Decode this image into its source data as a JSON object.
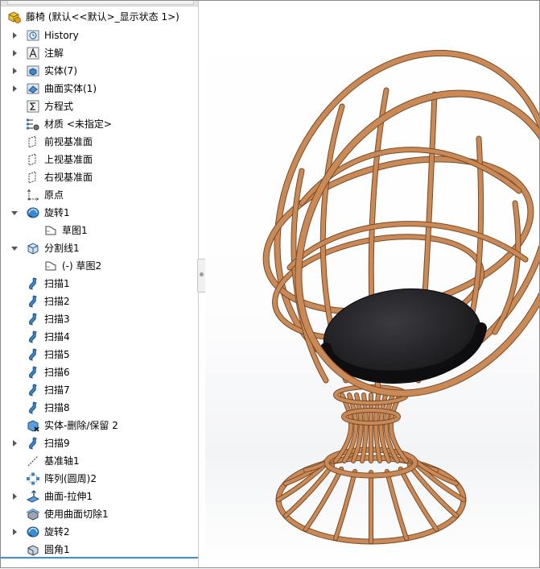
{
  "tree": {
    "root_label": "藤椅  (默认<<默认>_显示状态 1>)",
    "items": [
      {
        "label": "History",
        "icon": "history-icon",
        "expander": "collapsed",
        "indent": 0
      },
      {
        "label": "注解",
        "icon": "annotations-icon",
        "expander": "collapsed",
        "indent": 0
      },
      {
        "label": "实体(7)",
        "icon": "solid-bodies-icon",
        "expander": "collapsed",
        "indent": 0
      },
      {
        "label": "曲面实体(1)",
        "icon": "surface-bodies-icon",
        "expander": "collapsed",
        "indent": 0
      },
      {
        "label": "方程式",
        "icon": "equations-icon",
        "expander": "none",
        "indent": 0
      },
      {
        "label": "材质 <未指定>",
        "icon": "material-icon",
        "expander": "none",
        "indent": 0
      },
      {
        "label": "前视基准面",
        "icon": "plane-icon",
        "expander": "none",
        "indent": 0
      },
      {
        "label": "上视基准面",
        "icon": "plane-icon",
        "expander": "none",
        "indent": 0
      },
      {
        "label": "右视基准面",
        "icon": "plane-icon",
        "expander": "none",
        "indent": 0
      },
      {
        "label": "原点",
        "icon": "origin-icon",
        "expander": "none",
        "indent": 0
      },
      {
        "label": "旋转1",
        "icon": "revolve-icon",
        "expander": "expanded",
        "indent": 0
      },
      {
        "label": "草图1",
        "icon": "sketch-icon",
        "expander": "none",
        "indent": 1
      },
      {
        "label": "分割线1",
        "icon": "split-line-icon",
        "expander": "expanded",
        "indent": 0
      },
      {
        "label": "(-) 草图2",
        "icon": "sketch-icon",
        "expander": "none",
        "indent": 1
      },
      {
        "label": "扫描1",
        "icon": "sweep-icon",
        "expander": "none",
        "indent": 0
      },
      {
        "label": "扫描2",
        "icon": "sweep-icon",
        "expander": "none",
        "indent": 0
      },
      {
        "label": "扫描3",
        "icon": "sweep-icon",
        "expander": "none",
        "indent": 0
      },
      {
        "label": "扫描4",
        "icon": "sweep-icon",
        "expander": "none",
        "indent": 0
      },
      {
        "label": "扫描5",
        "icon": "sweep-icon",
        "expander": "none",
        "indent": 0
      },
      {
        "label": "扫描6",
        "icon": "sweep-icon",
        "expander": "none",
        "indent": 0
      },
      {
        "label": "扫描7",
        "icon": "sweep-icon",
        "expander": "none",
        "indent": 0
      },
      {
        "label": "扫描8",
        "icon": "sweep-icon",
        "expander": "none",
        "indent": 0
      },
      {
        "label": "实体-删除/保留 2",
        "icon": "delete-body-icon",
        "expander": "none",
        "indent": 0
      },
      {
        "label": "扫描9",
        "icon": "sweep-icon",
        "expander": "collapsed",
        "indent": 0
      },
      {
        "label": "基准轴1",
        "icon": "axis-icon",
        "expander": "none",
        "indent": 0
      },
      {
        "label": "阵列(圆周)2",
        "icon": "circular-pattern-icon",
        "expander": "none",
        "indent": 0
      },
      {
        "label": "曲面-拉伸1",
        "icon": "surface-extrude-icon",
        "expander": "collapsed",
        "indent": 0
      },
      {
        "label": "使用曲面切除1",
        "icon": "surface-cut-icon",
        "expander": "none",
        "indent": 0
      },
      {
        "label": "旋转2",
        "icon": "revolve-icon",
        "expander": "collapsed",
        "indent": 0
      },
      {
        "label": "圆角1",
        "icon": "fillet-icon",
        "expander": "none",
        "indent": 0
      }
    ]
  },
  "viewport": {
    "model": "rattan-egg-chair",
    "frame_color": "#c98a58",
    "frame_dark": "#7a4a26",
    "cushion_color": "#1e1e22"
  }
}
